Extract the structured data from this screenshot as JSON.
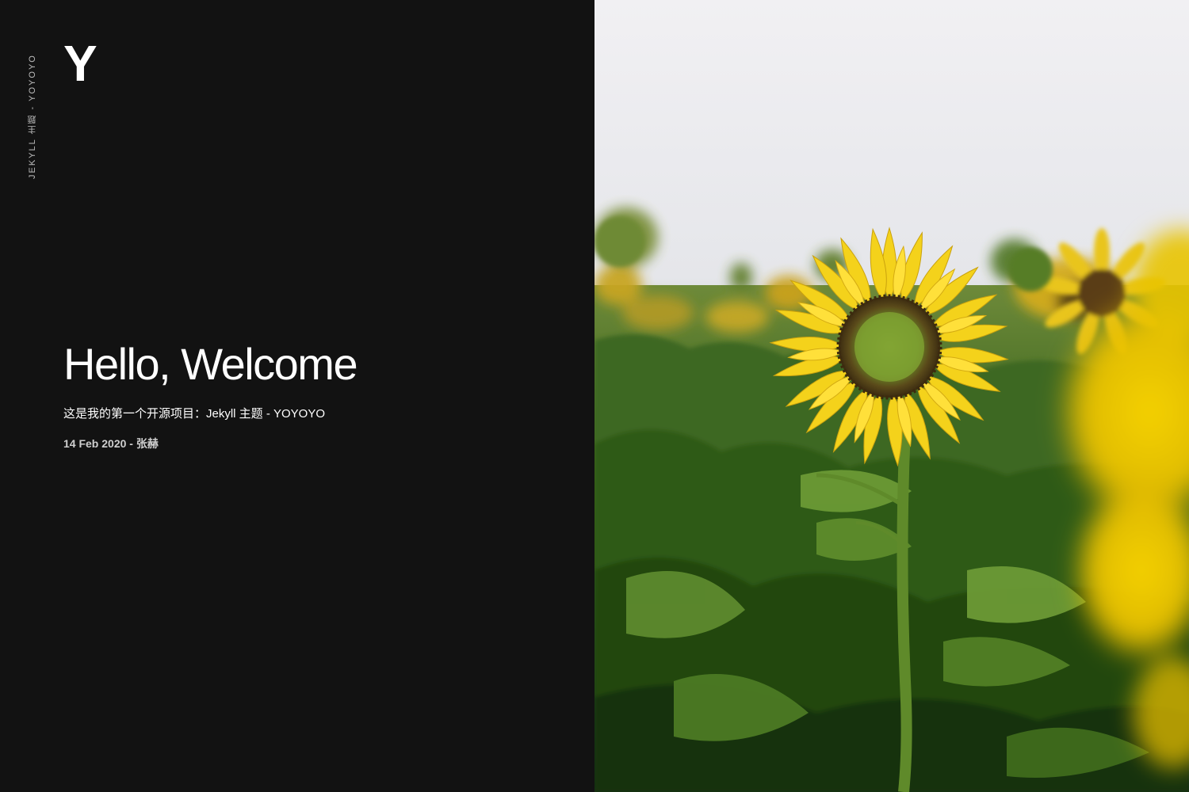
{
  "site": {
    "tagline": "JEKYLL 主题 - YOYOYO",
    "logo": "Y"
  },
  "post": {
    "title": "Hello, Welcome",
    "excerpt": "这是我的第一个开源项目：Jekyll 主题 - YOYOYO",
    "meta": "14 Feb 2020 - 张赫"
  },
  "colors": {
    "left_background": "#121212",
    "text": "#ffffff",
    "sky": "#e9e9ec",
    "petal": "#f3d21c",
    "leaf": "#3f6b22"
  },
  "hero_image": {
    "icon": "sunflower-field-photo"
  }
}
